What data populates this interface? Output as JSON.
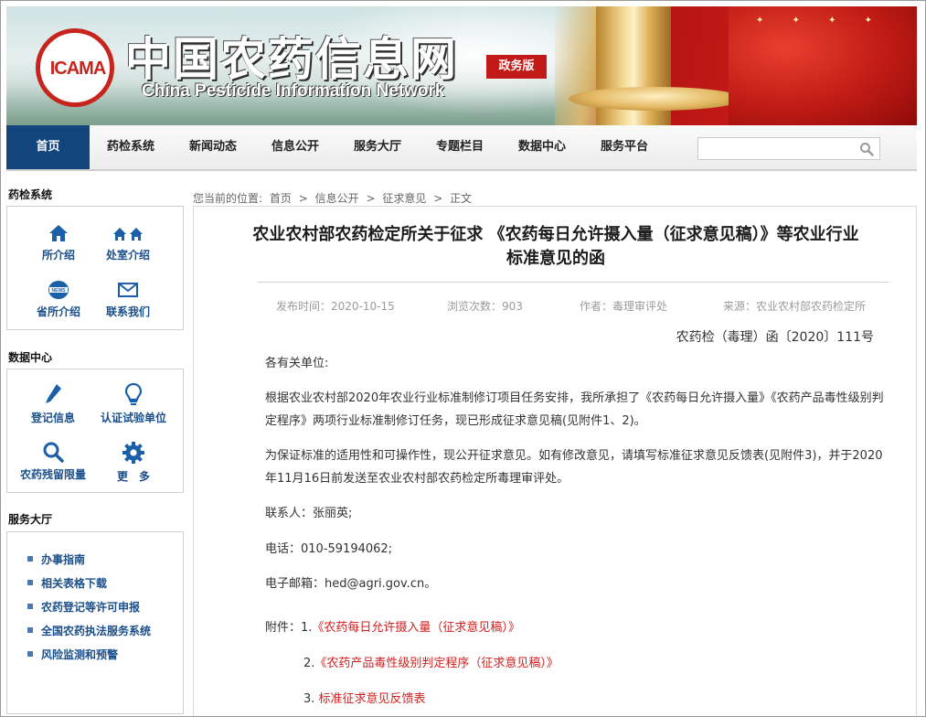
{
  "site": {
    "logo_text": "ICAMA",
    "title_cn": "中国农药信息网",
    "title_en": "China Pesticide Information Network",
    "badge": "政务版"
  },
  "nav": {
    "items": [
      {
        "label": "首页",
        "active": true
      },
      {
        "label": "药检系统"
      },
      {
        "label": "新闻动态"
      },
      {
        "label": "信息公开"
      },
      {
        "label": "服务大厅"
      },
      {
        "label": "专题栏目"
      },
      {
        "label": "数据中心"
      },
      {
        "label": "服务平台"
      }
    ],
    "search_placeholder": ""
  },
  "sidebar": {
    "yaojian": {
      "title": "药检系统",
      "items": [
        {
          "label": "所介绍",
          "icon": "home-icon"
        },
        {
          "label": "处室介绍",
          "icon": "homes-icon"
        },
        {
          "label": "省所介绍",
          "icon": "news-globe-icon"
        },
        {
          "label": "联系我们",
          "icon": "mail-icon"
        }
      ]
    },
    "data_center": {
      "title": "数据中心",
      "items": [
        {
          "label": "登记信息",
          "icon": "pencil-icon"
        },
        {
          "label": "认证试验单位",
          "icon": "lightbulb-icon"
        },
        {
          "label": "农药残留限量",
          "icon": "search-icon"
        },
        {
          "label": "更　多",
          "icon": "gear-icon"
        }
      ]
    },
    "service_hall": {
      "title": "服务大厅",
      "items": [
        {
          "label": "办事指南"
        },
        {
          "label": "相关表格下载"
        },
        {
          "label": "农药登记等许可申报"
        },
        {
          "label": "全国农药执法服务系统"
        },
        {
          "label": "风险监测和预警"
        }
      ]
    }
  },
  "breadcrumb": {
    "prefix": "您当前的位置:",
    "items": [
      "首页",
      "信息公开",
      "征求意见",
      "正文"
    ],
    "sep": ">"
  },
  "article": {
    "title_line1": "农业农村部农药检定所关于征求 《农药每日允许摄入量（征求意见稿）》等农业行业",
    "title_line2": "标准意见的函",
    "meta": {
      "date": "发布时间：2020-10-15",
      "views": "浏览次数：903",
      "author": "作者：毒理审评处",
      "source": "来源：农业农村部农药检定所"
    },
    "doc_no": "农药检（毒理）函〔2020〕111号",
    "greeting": "各有关单位:",
    "p1": "根据农业农村部2020年农业行业标准制修订项目任务安排，我所承担了《农药每日允许摄入量》《农药产品毒性级别判定程序》两项行业标准制修订任务，现已形成征求意见稿(见附件1、2)。",
    "p2": "为保证标准的适用性和可操作性，现公开征求意见。如有修改意见，请填写标准征求意见反馈表(见附件3)，并于2020年11月16日前发送至农业农村部农药检定所毒理审评处。",
    "contact": "联系人：张丽英;",
    "phone": "电话：010-59194062;",
    "email": "电子邮箱：hed@agri.gov.cn。",
    "attachments_label": "附件：",
    "attachments": [
      {
        "num": "1.",
        "title": "《农药每日允许摄入量（征求意见稿）》"
      },
      {
        "num": "2.",
        "title": "《农药产品毒性级别判定程序（征求意见稿）》"
      },
      {
        "num": "3.",
        "title": "标准征求意见反馈表"
      }
    ]
  },
  "colors": {
    "nav_active": "#12457c",
    "link_blue": "#1a4f8b",
    "link_red": "#d21f1f",
    "badge_red": "#c21a18"
  }
}
